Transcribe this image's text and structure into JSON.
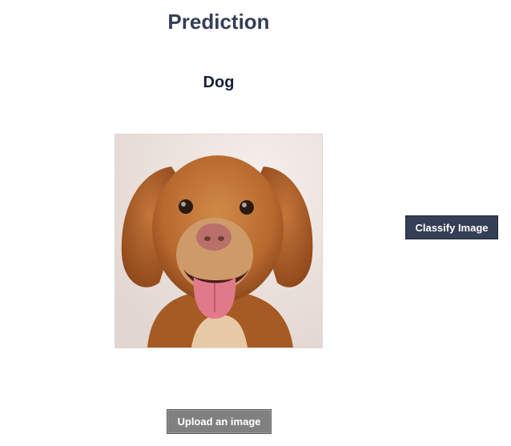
{
  "header": {
    "title": "Prediction"
  },
  "prediction": {
    "label": "Dog"
  },
  "image": {
    "subject": "dog-photo",
    "alt": "Dog"
  },
  "actions": {
    "classify_label": "Classify Image",
    "upload_label": "Upload an image"
  },
  "colors": {
    "title": "#343e55",
    "result": "#161f38",
    "classify_bg": "#343e55",
    "upload_bg": "#808080"
  }
}
